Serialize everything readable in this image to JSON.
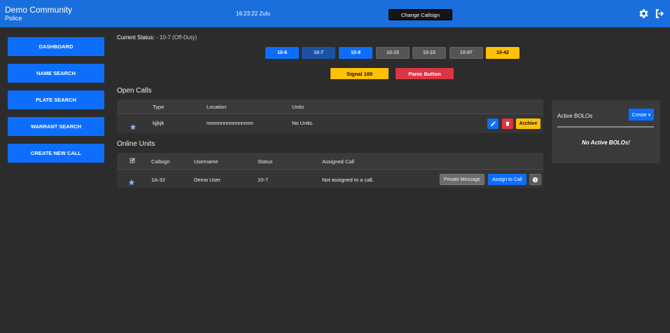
{
  "header": {
    "community": "Demo Community",
    "department": "Police",
    "clock": "16:23:22 Zulu",
    "change_callsign_label": "Change Callsign",
    "settings_icon": "gear-icon",
    "logout_icon": "logout-icon"
  },
  "sidebar": {
    "items": [
      {
        "label": "DASHBOARD"
      },
      {
        "label": "NAME SEARCH"
      },
      {
        "label": "PLATE SEARCH"
      },
      {
        "label": "WARRANT SEARCH"
      },
      {
        "label": "CREATE NEW CALL"
      }
    ]
  },
  "status": {
    "label": "Current Status:",
    "value": "- 10-7 (Off-Duty)",
    "codes": [
      {
        "label": "10-6",
        "style": "primary"
      },
      {
        "label": "10-7",
        "style": "dark-primary"
      },
      {
        "label": "10-8",
        "style": "primary"
      },
      {
        "label": "10-15",
        "style": "gray"
      },
      {
        "label": "10-23",
        "style": "gray"
      },
      {
        "label": "10-97",
        "style": "gray"
      },
      {
        "label": "10-42",
        "style": "warning"
      }
    ],
    "signal_label": "Signal 100",
    "panic_label": "Panic Button"
  },
  "open_calls": {
    "title": "Open Calls",
    "headers": {
      "type": "Type",
      "location": "Location",
      "units": "Units"
    },
    "rows": [
      {
        "type": "kjjkjk",
        "location": "nnnnnnnnnnnnnnnn",
        "units": "No Units.",
        "archive_label": "Archive"
      }
    ]
  },
  "online_units": {
    "title": "Online Units",
    "headers": {
      "callsign": "Callsign",
      "username": "Username",
      "status": "Status",
      "assigned": "Assigned Call"
    },
    "rows": [
      {
        "callsign": "1A-32",
        "username": "Demo User",
        "status": "10-7",
        "assigned": "Not assigned to a call.",
        "pm_label": "Private Message",
        "assign_label": "Assign to Call"
      }
    ]
  },
  "bolos": {
    "title": "Active BOLOs",
    "create_label": "Create ▾",
    "empty": "No Active BOLOs!"
  },
  "colors": {
    "topbar": "#1a6fdc",
    "primary": "#0d6efd",
    "warning": "#ffc107",
    "danger": "#dc3545",
    "background": "#2c2c2c"
  }
}
